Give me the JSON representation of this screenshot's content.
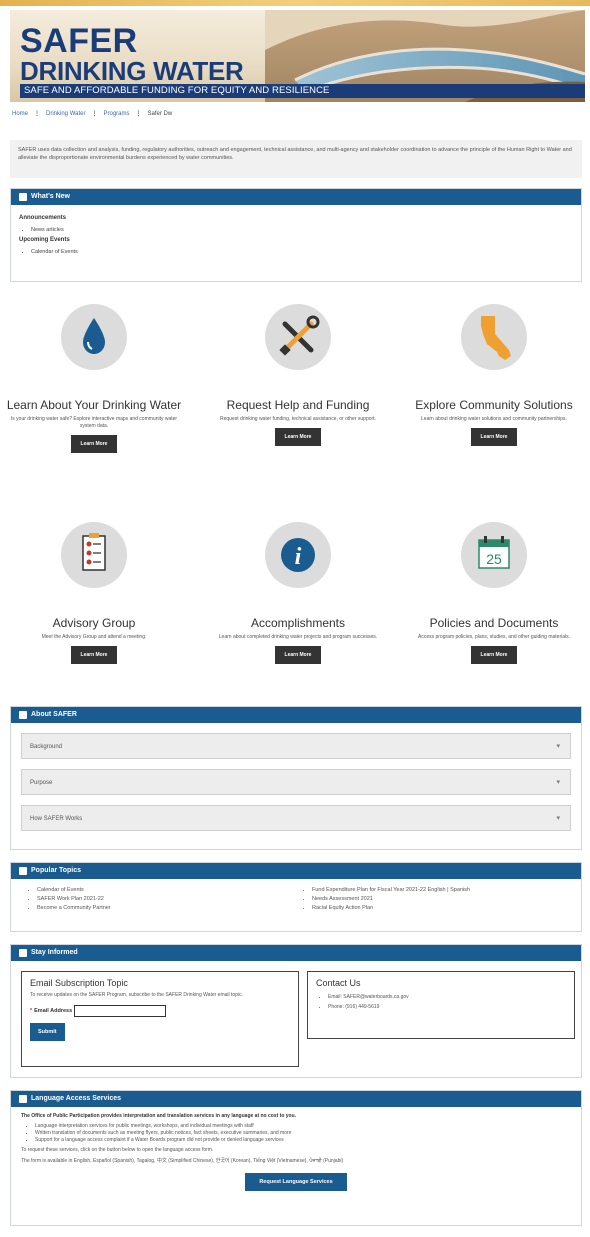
{
  "banner": {
    "title_line1": "SAFER",
    "title_line2": "DRINKING WATER",
    "tagline": "SAFE AND AFFORDABLE FUNDING FOR EQUITY AND RESILIENCE"
  },
  "breadcrumb": [
    "Home",
    "Drinking Water",
    "Programs",
    "Safer Dw"
  ],
  "intro": "SAFER uses data collection and analysis, funding, regulatory authorities, outreach and engagement, technical assistance, and multi-agency and stakeholder coordination to advance the principle of the Human Right to Water and alleviate the disproportionate environmental burdens experienced by water communities.",
  "whats_new": {
    "heading": "What's New",
    "announcements_label": "Announcements",
    "announcements": [
      "News articles"
    ],
    "events_label": "Upcoming Events",
    "events": [
      "Calendar of Events"
    ]
  },
  "tiles": [
    {
      "title": "Learn About Your Drinking Water",
      "desc": "Is your drinking water safe? Explore interactive maps and community water system data.",
      "button": "Learn More",
      "icon": "water-drop-icon"
    },
    {
      "title": "Request Help and Funding",
      "desc": "Request drinking water funding, technical assistance, or other support.",
      "button": "Learn More",
      "icon": "tools-icon"
    },
    {
      "title": "Explore Community Solutions",
      "desc": "Learn about drinking water solutions and community partnerships.",
      "button": "Learn More",
      "icon": "california-map-icon"
    },
    {
      "title": "Advisory Group",
      "desc": "Meet the Advisory Group and attend a meeting.",
      "button": "Learn More",
      "icon": "checklist-icon"
    },
    {
      "title": "Accomplishments",
      "desc": "Learn about completed drinking water projects and program successes.",
      "button": "Learn More",
      "icon": "info-icon"
    },
    {
      "title": "Policies and Documents",
      "desc": "Access program policies, plans, studies, and other guiding materials.",
      "button": "Learn More",
      "icon": "calendar-icon"
    }
  ],
  "calendar_day": "25",
  "about": {
    "heading": "About SAFER",
    "items": [
      "Background",
      "Purpose",
      "How SAFER Works"
    ]
  },
  "popular": {
    "heading": "Popular Topics",
    "left": [
      "Calendar of Events",
      "SAFER Work Plan 2021-22",
      "Become a Community Partner"
    ],
    "right": [
      "Fund Expenditure Plan for Fiscal Year 2021-22 English | Spanish",
      "Needs Assessment 2021",
      "Racial Equity Action Plan"
    ]
  },
  "stay": {
    "heading": "Stay Informed",
    "sub_title": "Email Subscription Topic",
    "sub_desc": "To receive updates on the SAFER Program, subscribe to the SAFER Drinking Water email topic.",
    "email_label": "Email Address",
    "required_mark": "*",
    "email_value": "",
    "submit": "Submit",
    "contact_title": "Contact Us",
    "contact_items": [
      "Email: SAFER@waterboards.ca.gov",
      "Phone: (916) 449-5619"
    ]
  },
  "lang": {
    "heading": "Language Access Services",
    "lead": "The Office of Public Participation provides interpretation and translation services in any language at no cost to you.",
    "items": [
      "Language interpretation services for public meetings, workshops, and individual meetings with staff",
      "Written translation of documents such as meeting flyers, public notices, fact sheets, executive summaries, and more",
      "Support for a language access complaint if a Water Boards program did not provide or denied language services"
    ],
    "note1": "To request these services, click on the button below to open the language access form.",
    "note2": "The form is available in English, Español (Spanish), Tagalog, 中文 (Simplified Chinese), 한국어 (Korean), Tiếng Việt (Vietnamese), ਪੰਜਾਬੀ (Punjabi)",
    "button": "Request Language Services"
  }
}
